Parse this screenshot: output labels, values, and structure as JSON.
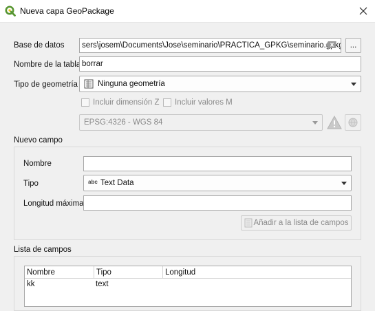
{
  "window": {
    "title": "Nueva capa GeoPackage",
    "icon": "qgis-logo-icon",
    "close_icon": "close-icon"
  },
  "form": {
    "database_label": "Base de datos",
    "database_value": "sers\\josem\\Documents\\Jose\\seminario\\PRACTICA_GPKG\\seminario.gpkg",
    "browse_label": "...",
    "table_label": "Nombre de la tabla",
    "table_value": "borrar",
    "geometry_label": "Tipo de geometría",
    "geometry_value": "Ninguna geometría",
    "include_z_label": "Incluir dimensión Z",
    "include_m_label": "Incluir valores M",
    "crs_value": "EPSG:4326 - WGS 84"
  },
  "new_field": {
    "group_label": "Nuevo campo",
    "name_label": "Nombre",
    "name_value": "",
    "type_label": "Tipo",
    "type_icon_text": "abc",
    "type_value": "Text Data",
    "length_label": "Longitud máxima",
    "length_value": "",
    "add_button_label": "Añadir a la lista de campos"
  },
  "field_list": {
    "group_label": "Lista de campos",
    "columns": [
      "Nombre",
      "Tipo",
      "Longitud"
    ],
    "rows": [
      {
        "name": "kk",
        "type": "text",
        "length": ""
      }
    ]
  },
  "colors": {
    "qgis_green": "#589632",
    "qgis_yellow": "#ee7913",
    "warning": "#b5b5b5"
  }
}
